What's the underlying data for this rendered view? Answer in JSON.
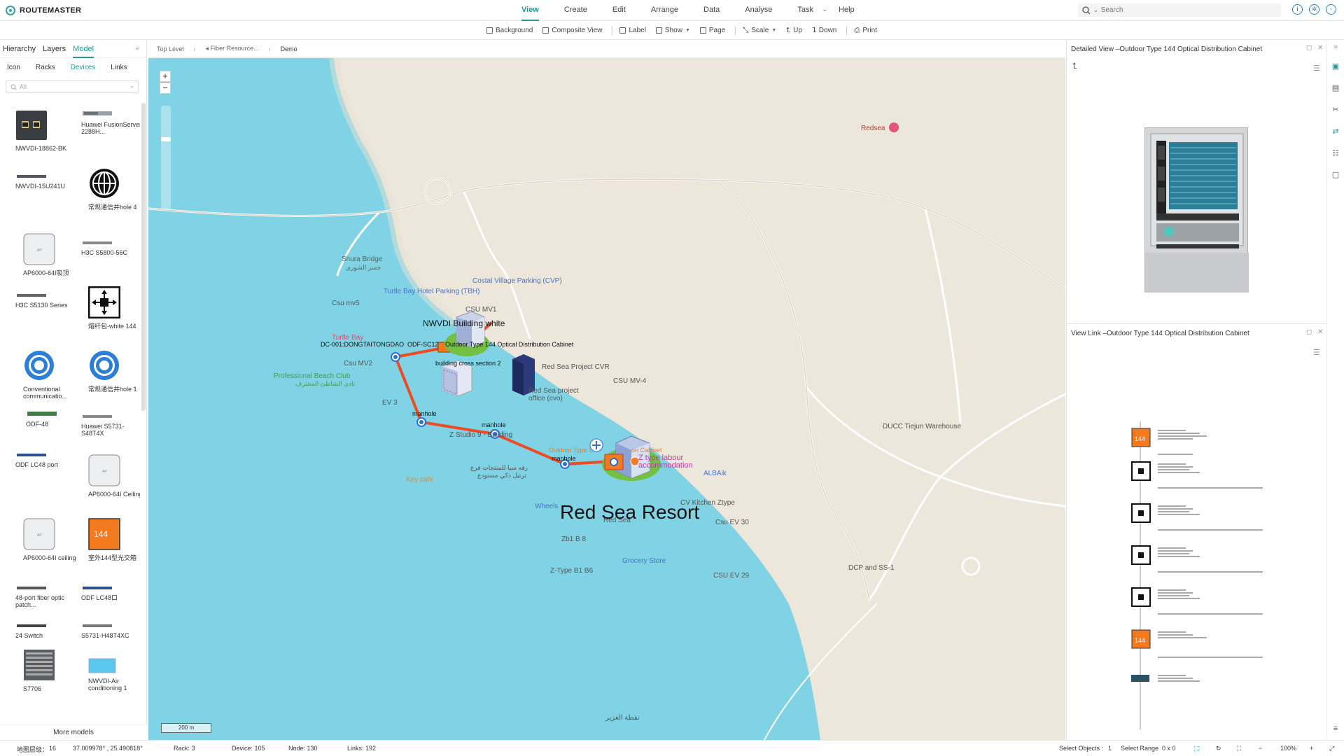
{
  "app": {
    "logo_text": "ROUTEMASTER"
  },
  "menu": [
    "View",
    "Create",
    "Edit",
    "Arrange",
    "Data",
    "Analyse",
    "Task",
    "Help"
  ],
  "menu_more": "⌄",
  "search": {
    "placeholder": "Search"
  },
  "toolbar": {
    "background": "Background",
    "composite_view": "Composite View",
    "label": "Label",
    "show": "Show",
    "page": "Page",
    "scale": "Scale",
    "up": "Up",
    "down": "Down",
    "print": "Print"
  },
  "left_panel": {
    "tabs": [
      "Hierarchy",
      "Layers",
      "Model"
    ],
    "subtabs": [
      "Icon",
      "Racks",
      "Devices",
      "Links"
    ],
    "filter": "All",
    "devices": [
      "NWVDI-18862-BK",
      "Huawei FusionServer 2288H...",
      "NWVDI-15U241U",
      "常规通信井hole 4",
      "AP6000-64I吸顶",
      "H3C S5800-56C",
      "H3C S5130 Series",
      "熔纤包-white 144",
      "Conventional communicatio...",
      "常规通信井hole 1",
      "ODF-48",
      "Huawei S5731-S48T4X",
      "ODF LC48 port",
      "AP6000-64I Ceiling",
      "AP6000-64I ceiling",
      "室外144型光交箱",
      "48-port fiber optic patch...",
      "ODF LC48口",
      "24 Switch",
      "S5731-H48T4XC",
      "S7706",
      "NWVDI-Air conditioning 1"
    ],
    "more_models": "More models"
  },
  "breadcrumb": [
    "Top Level",
    "Fiber Resource...",
    "Demo"
  ],
  "map": {
    "zoom_in": "+",
    "zoom_out": "−",
    "scale_label": "200 m",
    "big_label": "Red Sea Resort",
    "device_labels": {
      "nwvdi": "NWVDI Building white",
      "dc001": "DC-001:DONGTAITONGDAO",
      "odf": "ODF-SC12",
      "cabinet": "Outdoor Type 144 Optical Distribution Cabinet",
      "building_cross": "building cross section 2",
      "manhole1": "manhole",
      "manhole2": "manhole",
      "manhole3": "manhole",
      "outdoor_small": "Outdoor Type 1",
      "labour": "Z type labour accommodation",
      "labour_b": "on Cabinet"
    },
    "pois": [
      "Redsea",
      "Shura Bridge",
      "جسر الشورى",
      "Turtle Bay Hotel Parking (TBH)",
      "Costal Village Parking (CVP)",
      "Csu mv5",
      "CSU MV1",
      "Turtle Bay",
      "Csu MV2",
      "Professional Beach Club",
      "نادي الشاطئ المحترف",
      "Red Sea Project CVR",
      "CSU MV-4",
      "Red Sea project office (cvo)",
      "EV 3",
      "Z Studio 9 - Building",
      "Key cafe",
      "رفه سيا للمنتجات فرع",
      "ترتيل ذكي مستودع",
      "ALBAik",
      "Wheels",
      "Red Sea",
      "CV Kitchen Ztype",
      "Csu EV 30",
      "Zb1 B 8",
      "Grocery Store",
      "Z-Type B1 B6",
      "CSU EV 29",
      "DCP and SS-1",
      "DUCC Tiejun Warehouse",
      "نقطة الغزير"
    ]
  },
  "right_panel": {
    "detail_title": "Detailed View –Outdoor Type 144 Optical Distribution Cabinet",
    "link_title": "View Link –Outdoor Type 144 Optical Distribution Cabinet",
    "badge_144": "144"
  },
  "status": {
    "level_label": "地图层级：",
    "level_value": "16",
    "coords": "37.009978° , 25.490818°",
    "rack": "Rack: 3",
    "device": "Device: 105",
    "node": "Node: 130",
    "links": "Links: 192",
    "select_objects": "Select Objects :",
    "select_objects_value": "1",
    "select_range": "Select Range",
    "select_range_value": "0 x 0",
    "zoom": "100%",
    "zoom_plus": "+"
  },
  "colors": {
    "accent": "#1d9c94",
    "route": "#ef4a23",
    "water": "#7dd3e4",
    "land": "#ede6da",
    "orange": "#f47a1f"
  }
}
